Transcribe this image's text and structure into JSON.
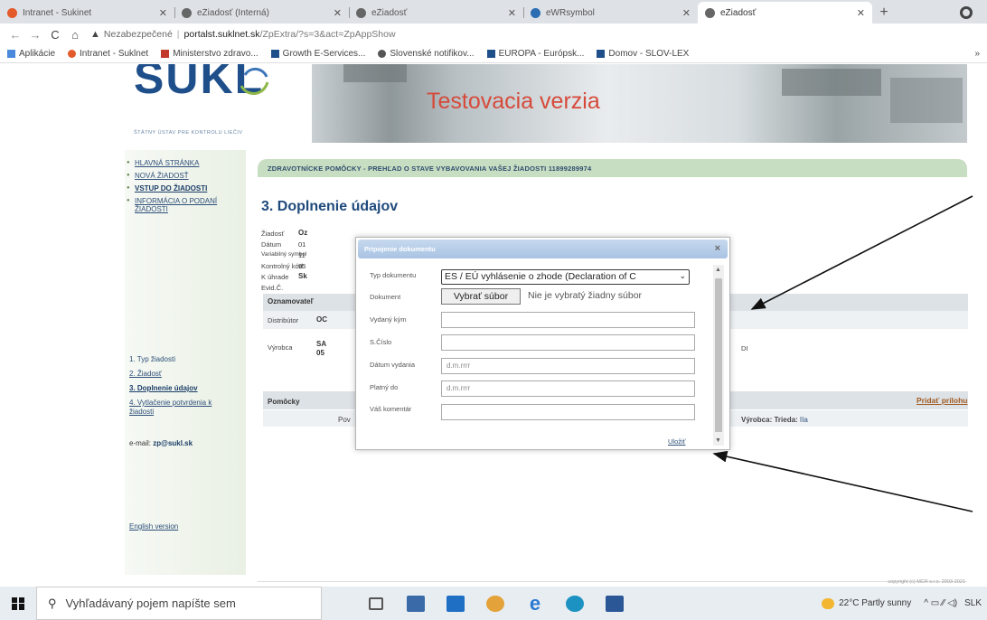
{
  "browser": {
    "tabs": [
      {
        "label": "Intranet - Sukinet",
        "fav": "#e35a2b",
        "active": false
      },
      {
        "label": "eŽiadosť (Interná)",
        "fav": "#555",
        "active": false
      },
      {
        "label": "eŽiadosť",
        "fav": "#555",
        "active": false
      },
      {
        "label": "eWRsymbol",
        "fav": "#2b6cb3",
        "active": false
      },
      {
        "label": "eŽiadosť",
        "fav": "#555",
        "active": true
      }
    ],
    "new_tab": "+",
    "address": {
      "warning": "▲",
      "not_secure": "Nezabezpečené",
      "separator": "|",
      "host": "portalst.suklnet.sk",
      "path": "/ZpExtra/?s=3&act=ZpAppShow"
    },
    "nav": {
      "back": "←",
      "forward": "→",
      "reload": "C",
      "home": "⌂"
    },
    "bookmarks": [
      {
        "label": "Aplikácie",
        "color": "#4a89dc"
      },
      {
        "label": "Intranet - Suklnet",
        "color": "#e35a2b"
      },
      {
        "label": "Ministerstvo zdravo...",
        "color": "#c0392b"
      },
      {
        "label": "Growth E-Services...",
        "color": "#1f4f8a"
      },
      {
        "label": "Slovenské notifikov...",
        "color": "#555"
      },
      {
        "label": "EUROPA - Európsk...",
        "color": "#1f4f8a"
      },
      {
        "label": "Domov - SLOV-LEX",
        "color": "#1f4f8a"
      }
    ],
    "bookmarks_more": "»"
  },
  "page": {
    "logo_text": "SUKL",
    "logo_sub": "ŠTÁTNY ÚSTAV PRE KONTROLU LIEČIV",
    "banner_text": "Testovacia verzia",
    "nav_links": [
      {
        "label": "HLAVNÁ STRÁNKA",
        "bold": false
      },
      {
        "label": "NOVÁ ŽIADOSŤ",
        "bold": false
      },
      {
        "label": "VSTUP DO ŽIADOSTI",
        "bold": true
      },
      {
        "label": "INFORMÁCIA O PODANÍ ŽIADOSTI",
        "bold": false
      }
    ],
    "steps": [
      {
        "label": "1. Typ žiadosti",
        "current": false,
        "link": false
      },
      {
        "label": "2. Žiadosť",
        "current": false,
        "link": true
      },
      {
        "label": "3. Doplnenie údajov",
        "current": true,
        "link": false
      },
      {
        "label": "4. Vytlačenie potvrdenia k žiadosti",
        "current": false,
        "link": true
      }
    ],
    "email_label": "e-mail:",
    "email_value": "zp@sukl.sk",
    "english_link": "English version",
    "header_bar": "ZDRAVOTNÍCKE POMÔCKY - PREHĽAD O STAVE VYBAVOVANIA VAŠEJ ŽIADOSTI 11899289974",
    "section_title": "3. Doplnenie údajov",
    "fields": [
      {
        "label": "Žiadosť",
        "value": "Oz"
      },
      {
        "label": "Dátum",
        "value": "01"
      },
      {
        "label": "Variabilný symbol",
        "value": "11"
      },
      {
        "label": "Kontrolný kód",
        "value": "95"
      },
      {
        "label": "K úhrade",
        "value": "Sk"
      },
      {
        "label": "Evid.Č.",
        "value": ""
      }
    ],
    "oznamovatel_label": "Oznamovateľ",
    "distributor_label": "Distribútor",
    "distributor_value": "OC",
    "vyrobca_label": "Výrobca",
    "vyrobca_value_1": "SA",
    "vyrobca_value_2": "05",
    "vyrobca_suffix": "DI",
    "pomocky_label": "Pomôcky",
    "pridat_prilohu": "Pridať prílohu",
    "pov_label": "Pov",
    "vyrobca_trieda": "Výrobca: Trieda:",
    "trieda_value": "IIa",
    "copyright": "copyright (c) MCR s.r.o. 2003-2021"
  },
  "modal": {
    "title": "Pripojenie dokumentu",
    "close": "×",
    "typ_label": "Typ dokumentu",
    "typ_value": "ES / EÚ vyhlásenie o zhode (Declaration of C",
    "dokument_label": "Dokument",
    "file_button": "Vybrať súbor",
    "no_file": "Nie je vybratý žiadny súbor",
    "vydany_label": "Vydaný kým",
    "cislo_label": "S.Číslo",
    "datum_label": "Dátum vydania",
    "datum_placeholder": "d.m.rrrr",
    "platny_label": "Platný do",
    "platny_placeholder": "d.m.rrrr",
    "koment_label": "Váš komentár",
    "save_link": "Uložiť"
  },
  "taskbar": {
    "search_placeholder": "Vyhľadávaný pojem napíšte sem",
    "weather": "22°C  Partly sunny",
    "tray_icons": "^  ▭  ⁄⁄  ◁)",
    "lang": "SLK"
  }
}
